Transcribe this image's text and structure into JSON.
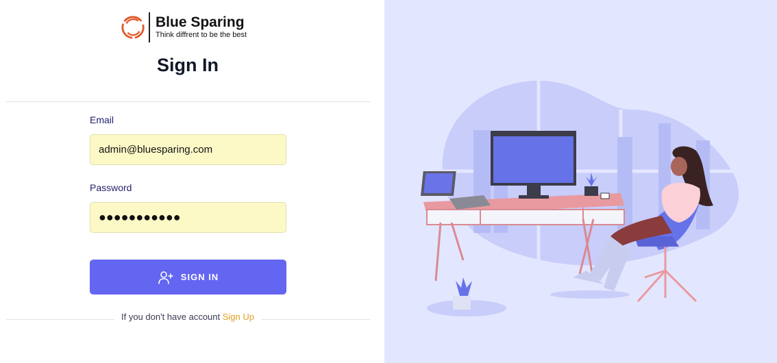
{
  "brand": {
    "name": "Blue Sparing",
    "tagline": "Think diffrent to be the best",
    "accent_color": "#e2582b"
  },
  "form": {
    "title": "Sign In",
    "email_label": "Email",
    "email_value": "admin@bluesparing.com",
    "password_label": "Password",
    "password_value": "●●●●●●●●●●●",
    "submit_label": "SIGN IN",
    "submit_icon": "user-plus-icon",
    "submit_color": "#6366f1",
    "field_bg_color": "#fdf9c7"
  },
  "footer": {
    "prompt": "If you don't have account",
    "link_label": "Sign Up",
    "link_color": "#e0a020"
  },
  "illustration": {
    "background_color": "#e3e6ff",
    "subject": "woman-at-desk-illustration"
  }
}
